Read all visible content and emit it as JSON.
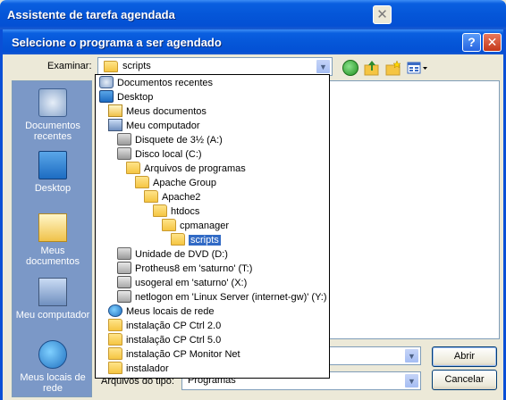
{
  "background_window": {
    "title": "Assistente de tarefa agendada",
    "close_glyph": "✕"
  },
  "dialog": {
    "title": "Selecione o programa a ser agendado",
    "help_glyph": "?",
    "close_glyph": "✕",
    "look_in_label": "Examinar:",
    "look_in_value": "scripts",
    "file_type_label": "Arquivos do tipo:",
    "file_type_value": "Programas",
    "open_button": "Abrir",
    "cancel_button": "Cancelar",
    "toolbar_icons": [
      "back-icon",
      "up-folder-icon",
      "new-folder-icon",
      "views-menu-icon"
    ]
  },
  "places": [
    {
      "label_line1": "Documentos",
      "label_line2": "recentes",
      "icon": "recent-documents-icon"
    },
    {
      "label_line1": "Desktop",
      "label_line2": "",
      "icon": "desktop-icon"
    },
    {
      "label_line1": "Meus",
      "label_line2": "documentos",
      "icon": "my-documents-icon"
    },
    {
      "label_line1": "Meu computador",
      "label_line2": "",
      "icon": "my-computer-icon"
    },
    {
      "label_line1": "Meus locais de",
      "label_line2": "rede",
      "icon": "network-places-icon"
    }
  ],
  "dropdown_items": [
    {
      "label": "Documentos recentes",
      "icon": "recent"
    },
    {
      "label": "Desktop",
      "icon": "desktop"
    },
    {
      "label": "Meus documentos",
      "icon": "docs"
    },
    {
      "label": "Meu computador",
      "icon": "computer"
    },
    {
      "label": "Disquete de 3½ (A:)",
      "icon": "drive"
    },
    {
      "label": "Disco local (C:)",
      "icon": "drive"
    },
    {
      "label": "Arquivos de programas",
      "icon": "folder"
    },
    {
      "label": "Apache Group",
      "icon": "folder"
    },
    {
      "label": "Apache2",
      "icon": "folder"
    },
    {
      "label": "htdocs",
      "icon": "folder"
    },
    {
      "label": "cpmanager",
      "icon": "folder"
    },
    {
      "label": "scripts",
      "icon": "folder",
      "selected": true
    },
    {
      "label": "Unidade de DVD (D:)",
      "icon": "drive"
    },
    {
      "label": "Protheus8 em 'saturno' (T:)",
      "icon": "netdrive"
    },
    {
      "label": "usogeral em 'saturno' (X:)",
      "icon": "netdrive"
    },
    {
      "label": "netlogon em 'Linux Server (internet-gw)' (Y:)",
      "icon": "netdrive"
    },
    {
      "label": "Meus locais de rede",
      "icon": "network"
    },
    {
      "label": "instalação CP Ctrl 2.0",
      "icon": "folder"
    },
    {
      "label": "instalação CP Ctrl 5.0",
      "icon": "folder"
    },
    {
      "label": "instalação CP Monitor Net",
      "icon": "folder"
    },
    {
      "label": "instalador",
      "icon": "folder"
    }
  ]
}
